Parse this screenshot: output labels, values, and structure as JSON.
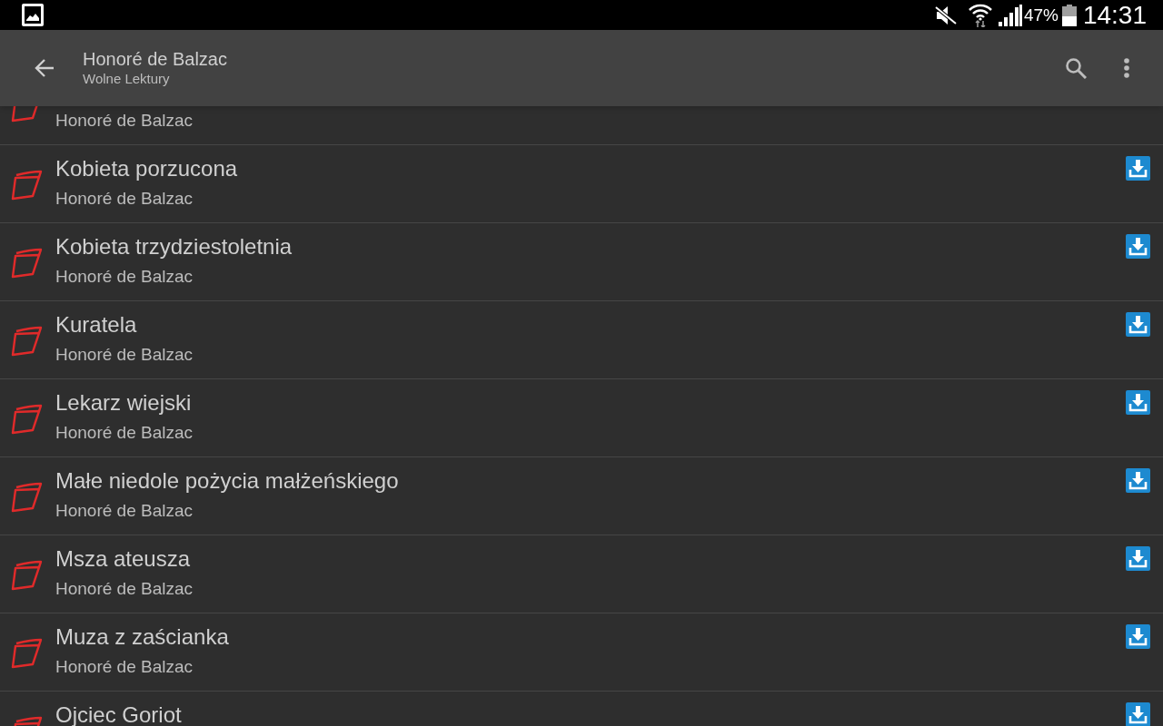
{
  "status_bar": {
    "battery": "47%",
    "time": "14:31"
  },
  "app_bar": {
    "title": "Honoré de Balzac",
    "subtitle": "Wolne Lektury"
  },
  "books": [
    {
      "author": "Honoré de Balzac"
    },
    {
      "title": "Kobieta porzucona",
      "author": "Honoré de Balzac",
      "download": true
    },
    {
      "title": "Kobieta trzydziestoletnia",
      "author": "Honoré de Balzac",
      "download": true
    },
    {
      "title": "Kuratela",
      "author": "Honoré de Balzac",
      "download": true
    },
    {
      "title": "Lekarz wiejski",
      "author": "Honoré de Balzac",
      "download": true
    },
    {
      "title": "Małe niedole pożycia małżeńskiego",
      "author": "Honoré de Balzac",
      "download": true
    },
    {
      "title": "Msza ateusza",
      "author": "Honoré de Balzac",
      "download": true
    },
    {
      "title": "Muza z zaścianka",
      "author": "Honoré de Balzac",
      "download": true
    },
    {
      "title": "Ojciec Goriot",
      "download": true
    }
  ]
}
